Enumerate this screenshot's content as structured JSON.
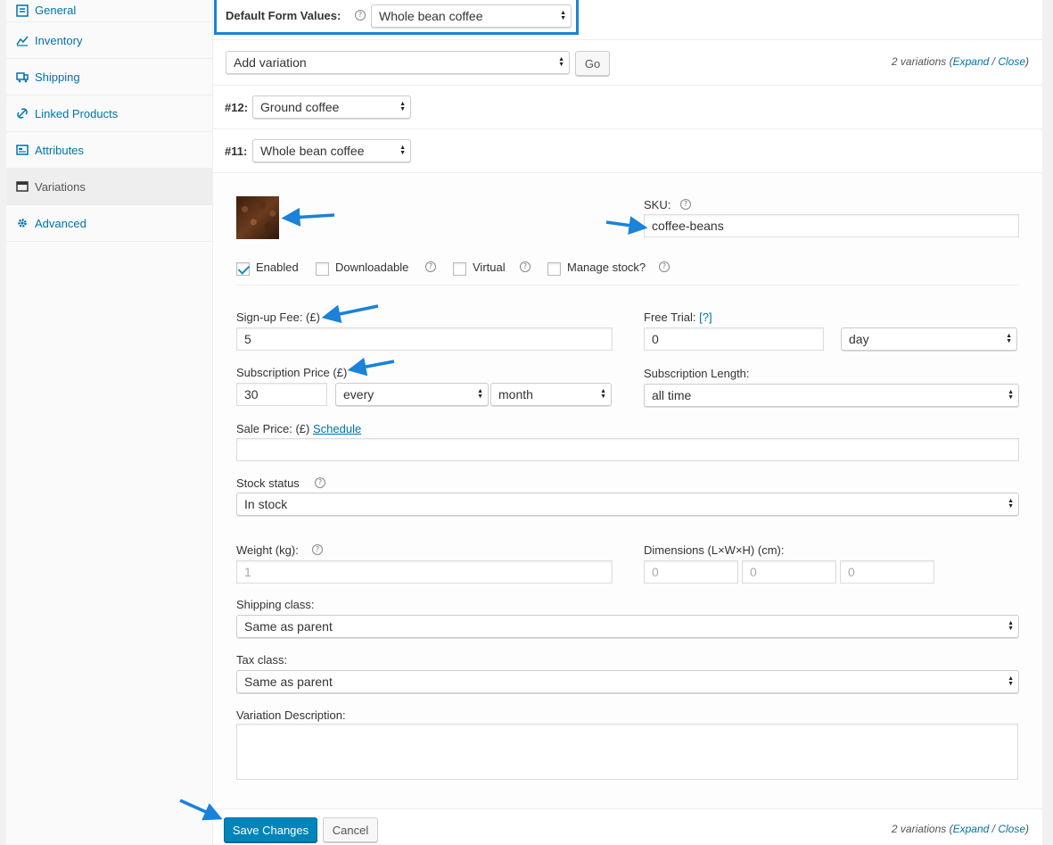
{
  "sidebar": {
    "items": [
      {
        "label": "General",
        "icon": "general-icon"
      },
      {
        "label": "Inventory",
        "icon": "inventory-icon"
      },
      {
        "label": "Shipping",
        "icon": "shipping-icon"
      },
      {
        "label": "Linked Products",
        "icon": "link-icon"
      },
      {
        "label": "Attributes",
        "icon": "attributes-icon"
      },
      {
        "label": "Variations",
        "icon": "variations-icon",
        "active": true
      },
      {
        "label": "Advanced",
        "icon": "gear-icon"
      }
    ]
  },
  "defaults": {
    "label": "Default Form Values:",
    "value": "Whole bean coffee"
  },
  "toolbar": {
    "add_select": "Add variation",
    "go_label": "Go",
    "count_text": "2 variations (",
    "expand": "Expand",
    "slash": " / ",
    "close": "Close",
    "end": ")"
  },
  "variations": [
    {
      "num": "#12:",
      "value": "Ground coffee"
    },
    {
      "num": "#11:",
      "value": "Whole bean coffee"
    }
  ],
  "form": {
    "sku_label": "SKU:",
    "sku_value": "coffee-beans",
    "enabled": "Enabled",
    "downloadable": "Downloadable",
    "virtual": "Virtual",
    "manage_stock": "Manage stock?",
    "signup_label": "Sign-up Fee: (£)",
    "signup_value": "5",
    "trial_label": "Free Trial:",
    "trial_help": "[?]",
    "trial_value": "0",
    "trial_period": "day",
    "sub_price_label": "Subscription Price (£)",
    "sub_price_value": "30",
    "sub_interval": "every",
    "sub_period": "month",
    "sub_length_label": "Subscription Length:",
    "sub_length_value": "all time",
    "sale_label": "Sale Price: (£)",
    "sale_schedule": "Schedule",
    "stock_status_label": "Stock status",
    "stock_status_value": "In stock",
    "weight_label": "Weight (kg):",
    "weight_placeholder": "1",
    "dimensions_label": "Dimensions (L×W×H) (cm):",
    "dim_l": "0",
    "dim_w": "0",
    "dim_h": "0",
    "shipping_label": "Shipping class:",
    "shipping_value": "Same as parent",
    "tax_label": "Tax class:",
    "tax_value": "Same as parent",
    "desc_label": "Variation Description:"
  },
  "footer": {
    "save": "Save Changes",
    "cancel": "Cancel"
  },
  "colors": {
    "accent": "#0073aa",
    "primary_button": "#0085ba",
    "highlight": "#1a82d8"
  }
}
